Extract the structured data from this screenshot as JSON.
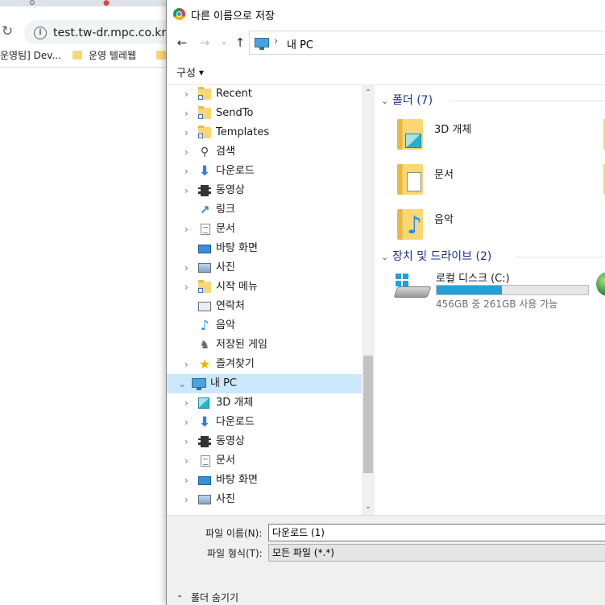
{
  "browser": {
    "omnibox_url": "test.tw-dr.mpc.co.kr",
    "bookmarks": [
      {
        "label": "운영팀] Dev..."
      },
      {
        "label": "운영 텔레웹"
      }
    ]
  },
  "dialog": {
    "title": "다른 이름으로 저장",
    "address_path": "내 PC",
    "organize_label": "구성",
    "nav_tree": [
      {
        "label": "Recent",
        "icon": "shortcut-folder-icon",
        "expandable": true
      },
      {
        "label": "SendTo",
        "icon": "shortcut-folder-icon",
        "expandable": true
      },
      {
        "label": "Templates",
        "icon": "shortcut-folder-icon",
        "expandable": true
      },
      {
        "label": "검색",
        "icon": "search-icon",
        "expandable": true
      },
      {
        "label": "다운로드",
        "icon": "download-icon",
        "expandable": true
      },
      {
        "label": "동영상",
        "icon": "video-icon",
        "expandable": true
      },
      {
        "label": "링크",
        "icon": "link-icon",
        "expandable": false
      },
      {
        "label": "문서",
        "icon": "document-icon",
        "expandable": true
      },
      {
        "label": "바탕 화면",
        "icon": "desktop-icon",
        "expandable": false
      },
      {
        "label": "사진",
        "icon": "picture-icon",
        "expandable": true
      },
      {
        "label": "시작 메뉴",
        "icon": "shortcut-folder-icon",
        "expandable": true
      },
      {
        "label": "연락처",
        "icon": "contacts-icon",
        "expandable": false
      },
      {
        "label": "음악",
        "icon": "music-icon",
        "expandable": false
      },
      {
        "label": "저장된 게임",
        "icon": "saved-games-icon",
        "expandable": false
      },
      {
        "label": "즐겨찾기",
        "icon": "favorites-star-icon",
        "expandable": true
      },
      {
        "label": "내 PC",
        "icon": "this-pc-icon",
        "expandable": true,
        "root": true,
        "selected": true
      },
      {
        "label": "3D 개체",
        "icon": "3d-objects-icon",
        "expandable": true
      },
      {
        "label": "다운로드",
        "icon": "download-icon",
        "expandable": true
      },
      {
        "label": "동영상",
        "icon": "video-icon",
        "expandable": true
      },
      {
        "label": "문서",
        "icon": "document-icon",
        "expandable": true
      },
      {
        "label": "바탕 화면",
        "icon": "desktop-icon",
        "expandable": true
      },
      {
        "label": "사진",
        "icon": "picture-icon",
        "expandable": true
      }
    ],
    "folders_group": {
      "header": "폴더 (7)",
      "items": [
        {
          "label": "3D 개체",
          "icon": "3d-objects-folder-icon"
        },
        {
          "label": "문서",
          "icon": "documents-folder-icon"
        },
        {
          "label": "음악",
          "icon": "music-folder-icon"
        }
      ]
    },
    "drives_group": {
      "header": "장치 및 드라이브 (2)",
      "drive": {
        "label": "로컬 디스크 (C:)",
        "space_text": "456GB 중 261GB 사용 가능",
        "used_fraction": 0.43,
        "bar_color": "#26a0da"
      }
    },
    "filename_label": "파일 이름(N):",
    "filename_value": "다운로드 (1)",
    "filetype_label": "파일 형식(T):",
    "filetype_value": "모든 파일 (*.*)",
    "hide_folders_label": "폴더 숨기기"
  }
}
